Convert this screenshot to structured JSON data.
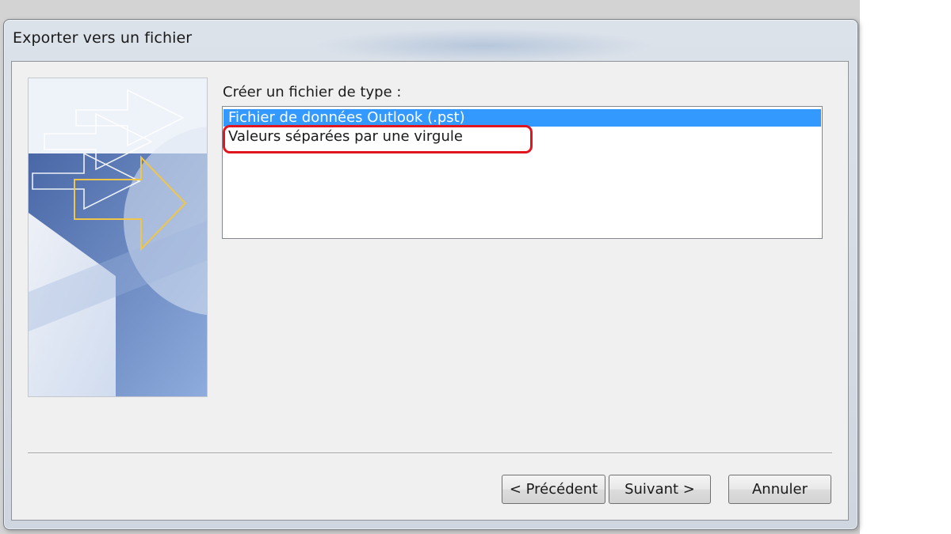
{
  "dialog": {
    "title": "Exporter vers un fichier"
  },
  "file_type": {
    "label": "Créer un fichier de type :",
    "options": [
      {
        "label": "Fichier de données Outlook (.pst)",
        "selected": true
      },
      {
        "label": "Valeurs séparées par une virgule",
        "selected": false
      }
    ],
    "highlight_color": "#e0151f",
    "selection_color": "#3399ff"
  },
  "buttons": {
    "previous": "< Précédent",
    "next": "Suivant >",
    "cancel": "Annuler"
  },
  "banner": {
    "icon": "export-arrows-icon",
    "accent": "#5f80bf",
    "arrow_color": "#f0c64a"
  }
}
